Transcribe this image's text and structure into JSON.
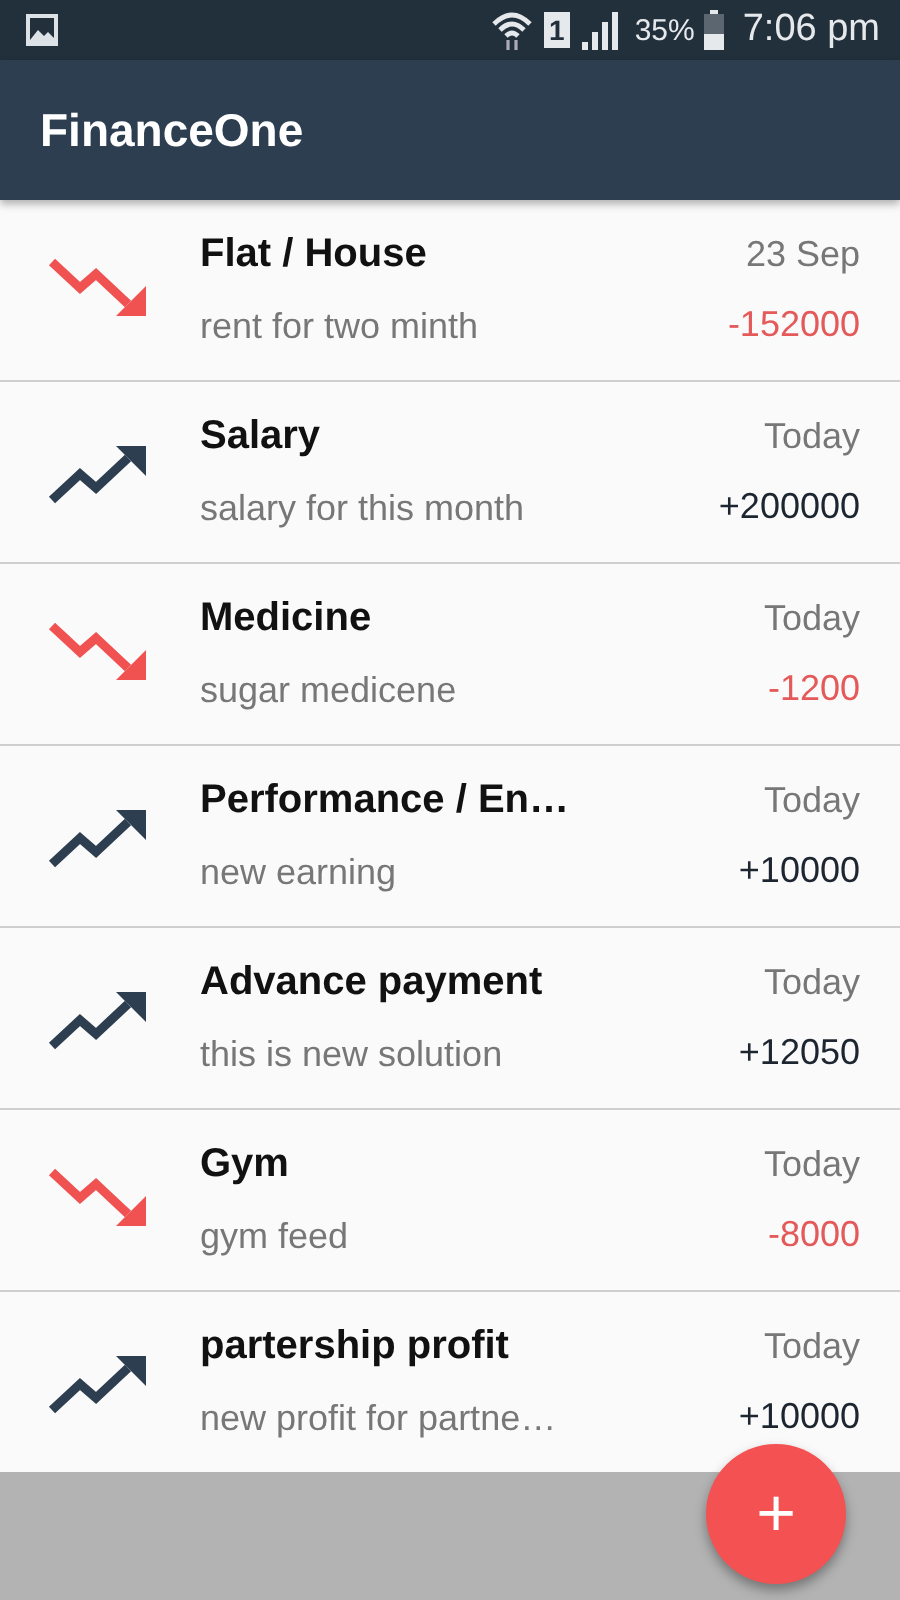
{
  "status_bar": {
    "sim": "1",
    "battery": "35%",
    "time": "7:06 pm"
  },
  "app_bar": {
    "title": "FinanceOne"
  },
  "transactions": [
    {
      "kind": "expense",
      "title": "Flat / House",
      "note": "rent for two minth",
      "date": "23 Sep",
      "amount": "-152000"
    },
    {
      "kind": "income",
      "title": "Salary",
      "note": "salary for this month",
      "date": "Today",
      "amount": "+200000"
    },
    {
      "kind": "expense",
      "title": "Medicine",
      "note": "sugar medicene",
      "date": "Today",
      "amount": "-1200"
    },
    {
      "kind": "income",
      "title": "Performance / En…",
      "note": "new earning",
      "date": "Today",
      "amount": "+10000"
    },
    {
      "kind": "income",
      "title": "Advance payment",
      "note": "this is new solution",
      "date": "Today",
      "amount": "+12050"
    },
    {
      "kind": "expense",
      "title": "Gym",
      "note": "gym feed",
      "date": "Today",
      "amount": "-8000"
    },
    {
      "kind": "income",
      "title": "partership profit",
      "note": "new profit for partne…",
      "date": "Today",
      "amount": "+10000"
    }
  ],
  "fab": {
    "label": "+"
  }
}
